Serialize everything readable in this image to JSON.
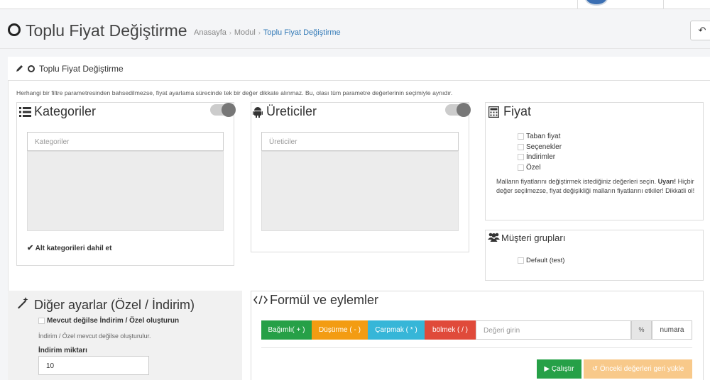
{
  "page": {
    "title": "Toplu Fiyat Değiştirme",
    "breadcrumb": [
      "Anasayfa",
      "Modul",
      "Toplu Fiyat Değiştirme"
    ],
    "back_icon": "↶"
  },
  "portlet": {
    "title": "Toplu Fiyat Değiştirme",
    "notice": "Herhangi bir filtre parametresinden bahsedilmezse, fiyat ayarlama sürecinde tek bir değer dikkate alınmaz. Bu, olası tüm parametre değerlerinin seçimiyle aynıdır."
  },
  "categories": {
    "title": "Kategoriler",
    "icon": "list-icon",
    "search_placeholder": "Kategoriler",
    "include_sub_label": "Alt kategorileri dahil et",
    "include_sub_checked": true
  },
  "manufacturers": {
    "title": "Üreticiler",
    "icon": "android-icon",
    "search_placeholder": "Üreticiler"
  },
  "price": {
    "title": "Fiyat",
    "icon": "calculator-icon",
    "options": [
      "Taban fiyat",
      "Seçenekler",
      "İndirimler",
      "Özel"
    ],
    "description_prefix": "Malların fiyatlarını değiştirmek istediğiniz değerleri seçin.",
    "warning": "Uyarı!",
    "description_suffix": "Hiçbir değer seçilmezse, fiyat değişikliği malların fiyatlarını etkiler! Dikkatli ol!"
  },
  "customer_groups": {
    "title": "Müşteri grupları",
    "icon": "users-icon",
    "options": [
      "Default (test)"
    ]
  },
  "other_settings": {
    "title": "Diğer ayarlar (Özel / İndirim)",
    "icon": "magic-wand-icon",
    "create_label": "Mevcut değilse İndirim / Özel oluşturun",
    "create_help": "İndirim / Özel mevcut değilse oluşturulur.",
    "discount_qty_label": "İndirim miktarı",
    "discount_qty_value": "10"
  },
  "formula": {
    "title": "Formül ve eylemler",
    "icon": "code-icon",
    "buttons": {
      "add": "Bağımlı( + )",
      "subtract": "Düşürme ( - )",
      "multiply": "Çarpmak ( * )",
      "divide": "bölmek ( / )"
    },
    "value_placeholder": "Değeri girin",
    "percent_label": "%",
    "number_label": "numara",
    "run_label": "Çalıştır",
    "restore_label": "Önceki değerleri geri yükle"
  },
  "colors": {
    "green": "#26a047",
    "orange": "#f39c12",
    "cyan": "#36b6d8",
    "red": "#e04a3a",
    "link": "#337ab7"
  }
}
